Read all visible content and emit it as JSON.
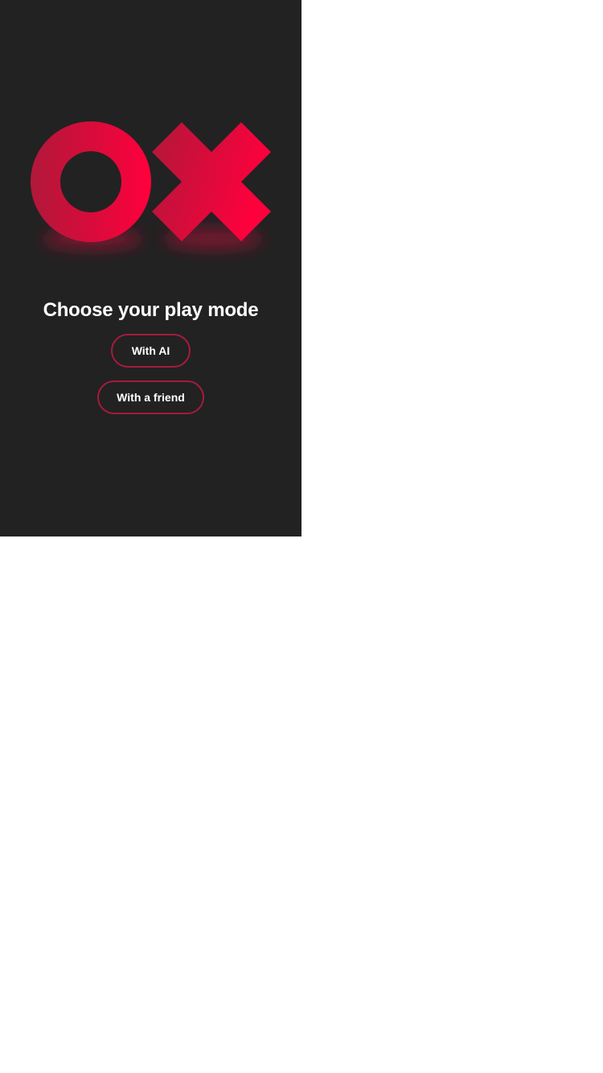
{
  "logo": {
    "icons": [
      "o-icon",
      "x-icon"
    ],
    "gradient": {
      "from": "#b0183a",
      "to": "#ff003c"
    }
  },
  "title": "Choose your play mode",
  "buttons": {
    "with_ai": "With AI",
    "with_friend": "With a friend"
  },
  "colors": {
    "background": "#222222",
    "accent": "#a51b3c",
    "text": "#ffffff"
  }
}
